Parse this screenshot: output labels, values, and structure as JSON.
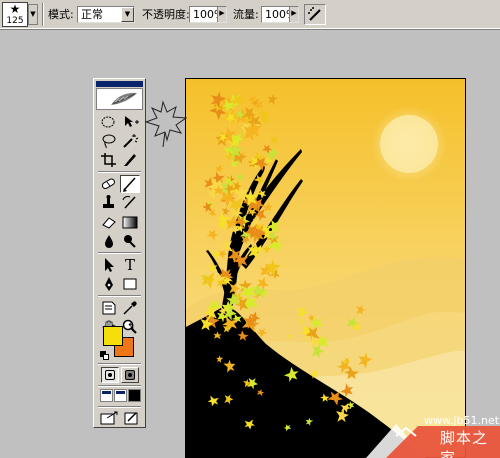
{
  "options_bar": {
    "brush_size": "125",
    "mode_label": "模式:",
    "mode_value": "正常",
    "opacity_label": "不透明度:",
    "opacity_value": "100%",
    "flow_label": "流量:",
    "flow_value": "100%"
  },
  "toolbox": {
    "tools": [
      "marquee-icon",
      "move-icon",
      "lasso-icon",
      "magic-wand-icon",
      "crop-icon",
      "slice-icon",
      "healing-brush-icon",
      "brush-icon",
      "clone-stamp-icon",
      "history-brush-icon",
      "eraser-icon",
      "gradient-icon",
      "blur-icon",
      "dodge-icon",
      "path-selection-icon",
      "type-icon",
      "pen-icon",
      "shape-icon",
      "notes-icon",
      "eyedropper-icon",
      "hand-icon",
      "zoom-icon"
    ],
    "selected_tool": "brush-icon",
    "type_tool_glyph": "T",
    "foreground_color": "#f5de0a",
    "background_color": "#ee7617"
  },
  "canvas": {
    "sky_top_color": "#f5c02a",
    "sky_bottom_color": "#fbe7a0",
    "hill_color": "#000000"
  },
  "watermark": {
    "url": "www.jb51.net",
    "text": "脚本之家"
  }
}
